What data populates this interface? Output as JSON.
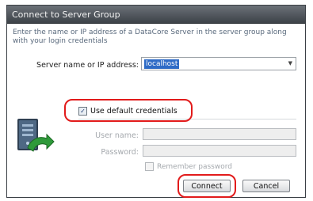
{
  "window": {
    "title": "Connect to Server Group"
  },
  "description": "Enter the name or IP address of a DataCore Server in the server group along with your login credentials",
  "server": {
    "label": "Server name or IP address:",
    "value": "localhost"
  },
  "use_default_credentials": {
    "label": "Use default credentials",
    "checked": true
  },
  "user_name": {
    "label": "User name:",
    "value": "",
    "enabled": false
  },
  "password": {
    "label": "Password:",
    "value": "",
    "enabled": false
  },
  "remember_password": {
    "label": "Remember password",
    "checked": false,
    "enabled": false
  },
  "buttons": {
    "connect": "Connect",
    "cancel": "Cancel"
  },
  "colors": {
    "titlebar": "#4a4f55",
    "selection": "#2e6bc6",
    "highlight": "#e21b1b",
    "description_text": "#5a6a7d",
    "disabled_text": "#a4a8ad"
  },
  "icons": {
    "dialog_icon": "server-connect-icon",
    "dropdown": "chevron-down-icon"
  }
}
